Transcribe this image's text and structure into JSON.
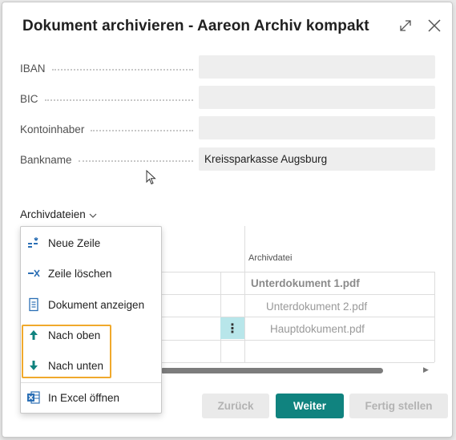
{
  "dialog": {
    "title": "Dokument archivieren - Aareon Archiv kompakt"
  },
  "fields": [
    {
      "label": "IBAN",
      "value": ""
    },
    {
      "label": "BIC",
      "value": ""
    },
    {
      "label": "Kontoinhaber",
      "value": ""
    },
    {
      "label": "Bankname",
      "value": "Kreissparkasse Augsburg"
    }
  ],
  "section": {
    "title": "Archivdateien"
  },
  "grid": {
    "column_header": "Archivdatei",
    "rows": [
      {
        "file": "Unterdokument 1.pdf",
        "bold": true
      },
      {
        "file": "Unterdokument 2.pdf",
        "bold": false
      },
      {
        "file": "Hauptdokument.pdf",
        "bold": false
      }
    ],
    "kebab": "⋮"
  },
  "menu": {
    "items": [
      {
        "label": "Neue Zeile",
        "icon": "new-line-icon"
      },
      {
        "label": "Zeile löschen",
        "icon": "delete-line-icon"
      },
      {
        "label": "Dokument anzeigen",
        "icon": "document-icon"
      },
      {
        "label": "Nach oben",
        "icon": "arrow-up-icon"
      },
      {
        "label": "Nach unten",
        "icon": "arrow-down-icon"
      },
      {
        "label": "In Excel öffnen",
        "icon": "excel-icon"
      }
    ]
  },
  "buttons": {
    "back": "Zurück",
    "next": "Weiter",
    "finish": "Fertig stellen"
  },
  "colors": {
    "accent": "#10837f",
    "highlight": "#f0a92c",
    "selected_cell": "#b8e6ea"
  }
}
